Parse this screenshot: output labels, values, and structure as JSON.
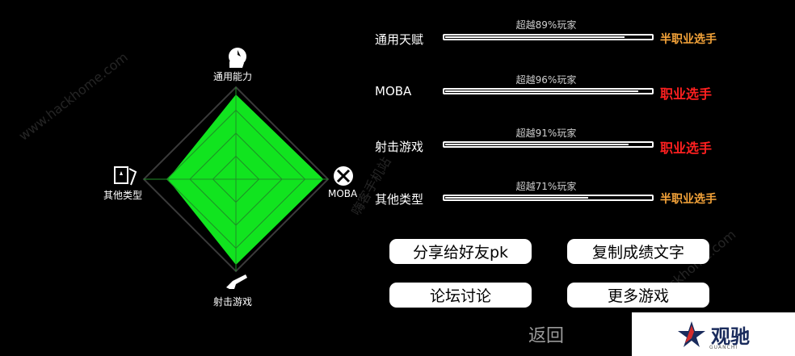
{
  "radar": {
    "axes": [
      {
        "key": "top",
        "label": "通用能力",
        "icon": "head-profile-icon",
        "value": 0.92
      },
      {
        "key": "right",
        "label": "MOBA",
        "icon": "crossed-swords-icon",
        "value": 0.95
      },
      {
        "key": "bottom",
        "label": "射击游戏",
        "icon": "rifle-icon",
        "value": 0.93
      },
      {
        "key": "left",
        "label": "其他类型",
        "icon": "playing-card-icon",
        "value": 0.74
      }
    ],
    "fill_color": "#11e41f",
    "grid_color": "#1f8f27",
    "outline_color": "#3a3a3a"
  },
  "stats": [
    {
      "label": "通用天赋",
      "percent_text": "超越89%玩家",
      "percent": 0.89,
      "rank": "半职业选手",
      "rank_color": "#f5a43a"
    },
    {
      "label": "MOBA",
      "percent_text": "超越96%玩家",
      "percent": 0.96,
      "rank": "职业选手",
      "rank_color": "#ff2020"
    },
    {
      "label": "射击游戏",
      "percent_text": "超越91%玩家",
      "percent": 0.91,
      "rank": "职业选手",
      "rank_color": "#ff2020"
    },
    {
      "label": "其他类型",
      "percent_text": "超越71%玩家",
      "percent": 0.71,
      "rank": "半职业选手",
      "rank_color": "#f5a43a"
    }
  ],
  "buttons": {
    "share": "分享给好友pk",
    "copy": "复制成绩文字",
    "forum": "论坛讨论",
    "more": "更多游戏"
  },
  "back": "返回",
  "watermarks": {
    "left": "www.hackhome.com",
    "center": "嗨客手机站",
    "right": "hackhome.com"
  },
  "logo": {
    "text": "观驰",
    "sub": "GUANCHI"
  }
}
